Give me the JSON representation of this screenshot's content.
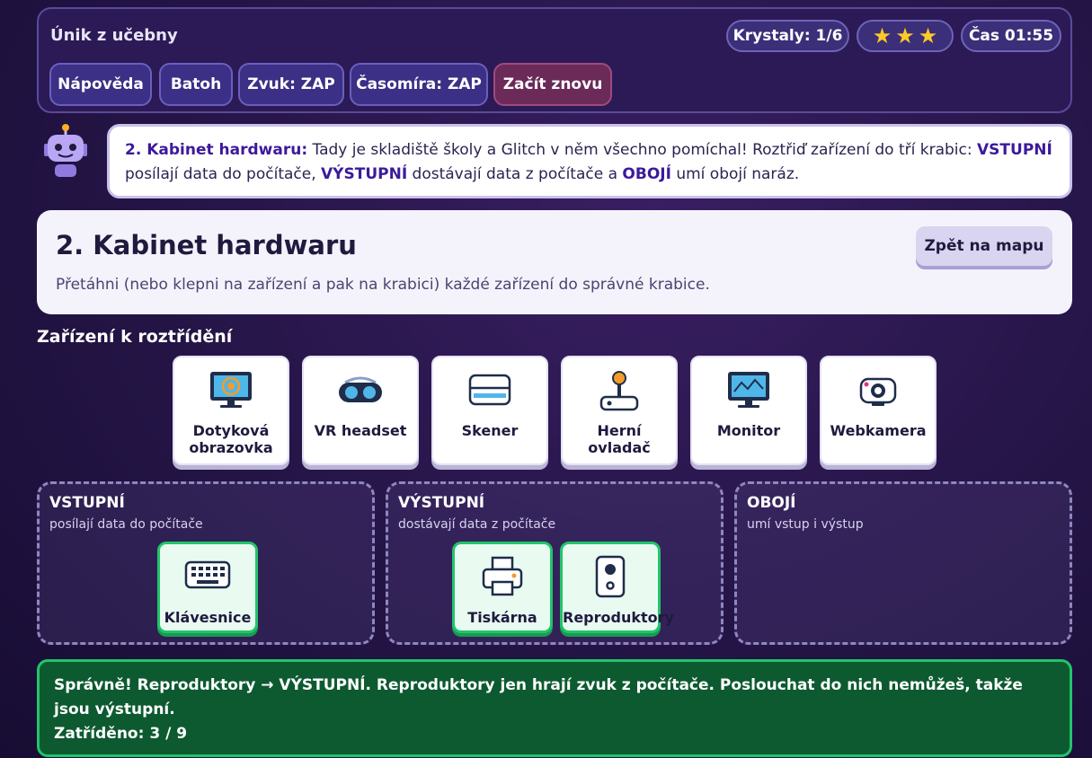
{
  "header": {
    "title": "Únik z učebny",
    "crystals": "Krystaly: 1/6",
    "stars": [
      "★",
      "★",
      "★"
    ],
    "timer": "Čas 01:55",
    "buttons": {
      "help": "Nápověda",
      "backpack": "Batoh",
      "sound": "Zvuk: ZAP",
      "timer_toggle": "Časomíra: ZAP",
      "restart": "Začít znovu"
    }
  },
  "guide": {
    "prefix": "2. Kabinet hardwaru:",
    "text1": " Tady je skladiště školy a Glitch v něm všechno pomíchal! Roztřiď zařízení do tří krabic: ",
    "kw_input": "VSTUPNÍ",
    "text2": " posílají data do počítače, ",
    "kw_output": "VÝSTUPNÍ",
    "text3": " dostávají data z počítače a ",
    "kw_both": "OBOJÍ",
    "text4": " umí obojí naráz."
  },
  "level": {
    "title": "2. Kabinet hardwaru",
    "instructions": "Přetáhni (nebo klepni na zařízení a pak na krabici) každé zařízení do správné krabice.",
    "back_button": "Zpět na mapu"
  },
  "devices_heading": "Zařízení k roztřídění",
  "devices": [
    {
      "label": "Dotyková obrazovka",
      "icon": "touchscreen-icon"
    },
    {
      "label": "VR headset",
      "icon": "vr-headset-icon"
    },
    {
      "label": "Skener",
      "icon": "scanner-icon"
    },
    {
      "label": "Herní ovladač",
      "icon": "joystick-icon"
    },
    {
      "label": "Monitor",
      "icon": "monitor-icon"
    },
    {
      "label": "Webkamera",
      "icon": "webcam-icon"
    }
  ],
  "bins": [
    {
      "title": "VSTUPNÍ",
      "subtitle": "posílají data do počítače",
      "items": [
        {
          "label": "Klávesnice",
          "icon": "keyboard-icon"
        }
      ]
    },
    {
      "title": "VÝSTUPNÍ",
      "subtitle": "dostávají data z počítače",
      "items": [
        {
          "label": "Tiskárna",
          "icon": "printer-icon"
        },
        {
          "label": "Reproduktory",
          "icon": "speaker-icon"
        }
      ]
    },
    {
      "title": "OBOJÍ",
      "subtitle": "umí vstup i výstup",
      "items": []
    }
  ],
  "feedback": {
    "message": "Správně! Reproduktory → VÝSTUPNÍ. Reproduktory jen hrají zvuk z počítače. Poslouchat do nich nemůžeš, takže jsou výstupní.",
    "progress": "Zatříděno: 3 / 9"
  },
  "colors": {
    "accent_correct": "#22c46b",
    "feedback_bg": "#0d5a30",
    "keyword": "#3b1a9a",
    "star": "#ffc928"
  }
}
